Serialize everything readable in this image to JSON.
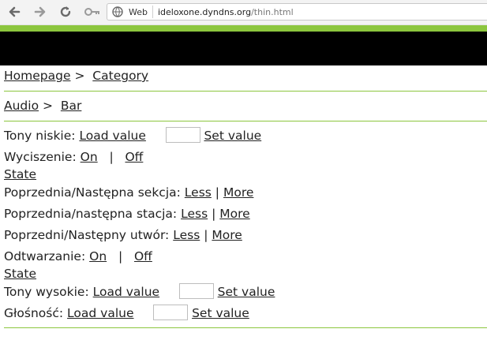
{
  "browser": {
    "web_label": "Web",
    "url_host": "ideloxone.dyndns.org",
    "url_path": "/thin.html"
  },
  "breadcrumb1": {
    "home": "Homepage",
    "sep": ">",
    "category": "Category"
  },
  "breadcrumb2": {
    "audio": "Audio",
    "sep": ">",
    "bar": "Bar"
  },
  "controls": {
    "bass": {
      "label": "Tony niskie:",
      "load": "Load value",
      "set": "Set value"
    },
    "mute": {
      "label": "Wyciszenie:",
      "on": "On",
      "sep": "|",
      "off": "Off",
      "state": "State"
    },
    "section": {
      "label": "Poprzednia/Następna sekcja:",
      "less": "Less",
      "sep": "|",
      "more": "More"
    },
    "station": {
      "label": "Poprzednia/następna stacja:",
      "less": "Less",
      "sep": "|",
      "more": "More"
    },
    "track": {
      "label": "Poprzedni/Następny utwór:",
      "less": "Less",
      "sep": "|",
      "more": "More"
    },
    "play": {
      "label": "Odtwarzanie:",
      "on": "On",
      "sep": "|",
      "off": "Off",
      "state": "State"
    },
    "treble": {
      "label": "Tony wysokie:",
      "load": "Load value",
      "set": "Set value"
    },
    "volume": {
      "label": "Głośność:",
      "load": "Load value",
      "set": "Set value"
    }
  },
  "colors": {
    "accent_green": "#8cc63e",
    "header_black": "#000000"
  }
}
